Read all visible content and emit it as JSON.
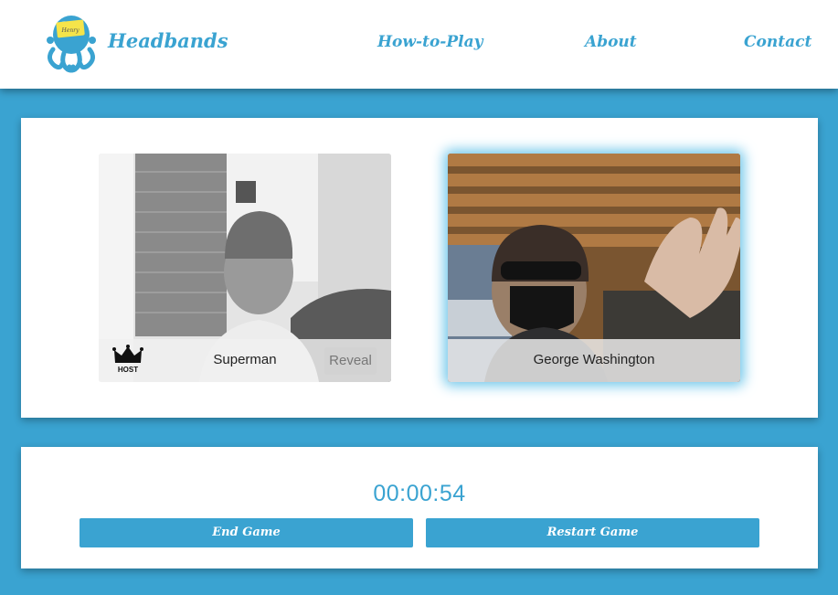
{
  "header": {
    "brand": "Headbands",
    "logo_note": "Henry",
    "nav": [
      "How-to-Play",
      "About",
      "Contact"
    ]
  },
  "players": [
    {
      "name": "Superman",
      "host_label": "HOST",
      "reveal_label": "Reveal",
      "feed": "grayscale"
    },
    {
      "name": "George Washington",
      "feed": "color",
      "highlighted": true
    }
  ],
  "controls": {
    "timer": "00:00:54",
    "end_label": "End Game",
    "restart_label": "Restart Game"
  },
  "colors": {
    "accent": "#3aa3d1",
    "panel": "#ffffff",
    "tile_bar": "#f0f0f0"
  },
  "icons": [
    "octopus-logo-icon",
    "crown-icon"
  ]
}
